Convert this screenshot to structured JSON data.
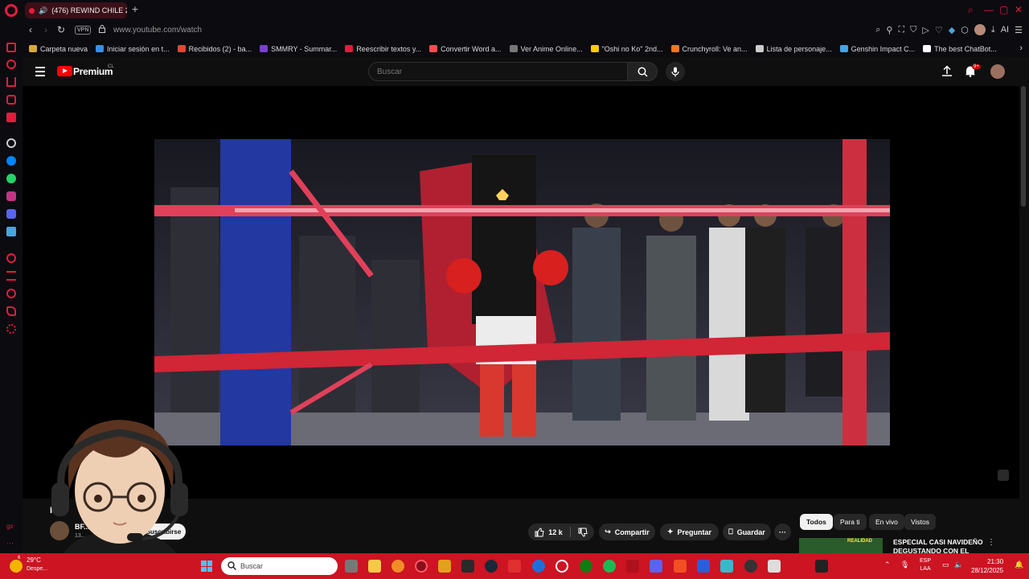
{
  "browser": {
    "tab_title": "(476) REWIND CHILE 2",
    "url": "www.youtube.com/watch",
    "vpn_label": "VPN",
    "toolbar_ai": "AI"
  },
  "bookmarks": [
    {
      "label": "Carpeta nueva",
      "color": "#d9a640"
    },
    {
      "label": "Iniciar sesión en t...",
      "color": "#3a8ee6"
    },
    {
      "label": "Recibidos (2) - ba...",
      "color": "#ea4335"
    },
    {
      "label": "SMMRY - Summar...",
      "color": "#7a3fd0"
    },
    {
      "label": "Reescribir textos y...",
      "color": "#e21d3c"
    },
    {
      "label": "Convertir Word a...",
      "color": "#ff4d4d"
    },
    {
      "label": "Ver Anime Online...",
      "color": "#777777"
    },
    {
      "label": "\"Oshi no Ko\" 2nd...",
      "color": "#ffcc00"
    },
    {
      "label": "Crunchyroll: Ve an...",
      "color": "#f47521"
    },
    {
      "label": "Lista de personaje...",
      "color": "#cccccc"
    },
    {
      "label": "Genshin Impact C...",
      "color": "#4aa3df"
    },
    {
      "label": "The best ChatBot...",
      "color": "#ffffff"
    }
  ],
  "youtube": {
    "brand": "Premium",
    "country": "CL",
    "search_placeholder": "Buscar",
    "notification_badge": "9+"
  },
  "video": {
    "title": "R...",
    "channel_name": "BF...",
    "channel_subs": "13...",
    "subscribe_label": "Suscribirse",
    "likes": "12 k",
    "share_label": "Compartir",
    "ask_label": "Preguntar",
    "save_label": "Guardar"
  },
  "recommendations": {
    "filters": [
      "Todos",
      "Para ti",
      "En vivo",
      "Vistos"
    ],
    "first_title": "ESPECIAL CASI NAVIDEÑO DEGUSTANDO CON EL GOTH",
    "thumb_text": "REALIDAD"
  },
  "taskbar": {
    "temperature": "29°C",
    "weather_text": "Despe...",
    "weather_badge": "6",
    "search_placeholder": "Buscar",
    "lang_line1": "ESP",
    "lang_line2": "LAA",
    "time": "21:30",
    "date": "28/12/2025"
  },
  "colors": {
    "opera_red": "#e21d3c",
    "taskbar_red": "#cc1422",
    "yt_red": "#ff0000"
  }
}
